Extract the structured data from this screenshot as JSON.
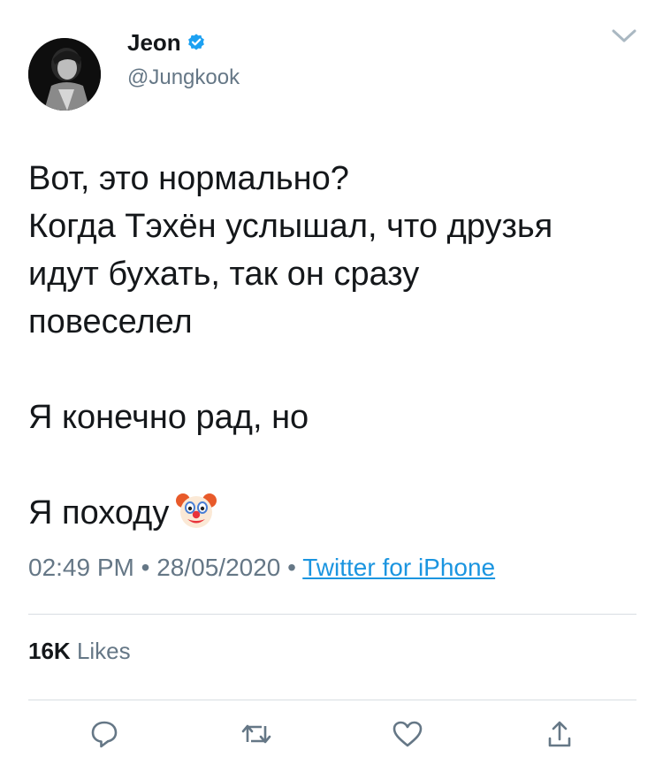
{
  "author": {
    "name": "Jeon",
    "handle": "@Jungkook",
    "verified": true
  },
  "tweet": {
    "line1": "Вот, это нормально?",
    "line2": "Когда Тэхён услышал, что друзья",
    "line3": "идут бухать, так он сразу",
    "line4": "повеселел",
    "line5": "Я конечно рад, но",
    "line6": "Я походу",
    "emoji": "clown-face"
  },
  "meta": {
    "time": "02:49 PM",
    "sep1": "•",
    "date": "28/05/2020",
    "sep2": "•",
    "source": "Twitter for iPhone"
  },
  "stats": {
    "likes_count": "16K",
    "likes_label": "Likes"
  },
  "actions": [
    "reply-icon",
    "retweet-icon",
    "like-icon",
    "share-icon"
  ],
  "colors": {
    "text": "#14171a",
    "secondary": "#657786",
    "link": "#1b95e0",
    "verified": "#1da1f2",
    "divider": "#d8dde2"
  }
}
